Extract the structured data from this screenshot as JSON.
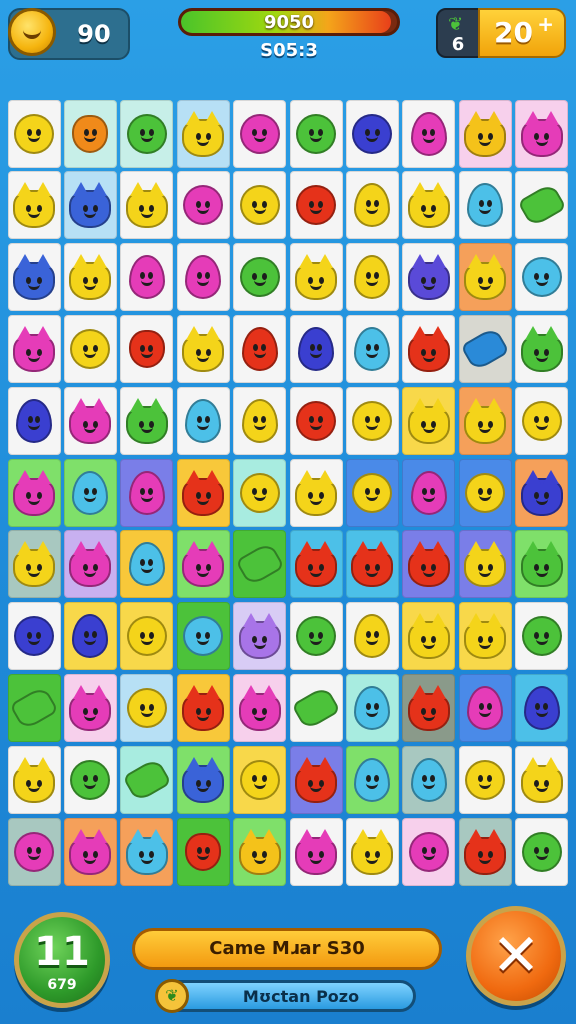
{
  "hud": {
    "coins": "90",
    "score": "9050",
    "score_progress": 0.97,
    "timer": "S05:3",
    "moves": "6",
    "gold": "20",
    "icons": {
      "coin": "smiley-coin-icon",
      "moves": "leaf-icon",
      "gold_add": "plus-icon"
    }
  },
  "board": {
    "rows": [
      [
        [
          "#f5f5f5",
          "round",
          "#f4d41a"
        ],
        [
          "#c7efe8",
          "veg",
          "#f08a1a"
        ],
        [
          "#c7efe8",
          "round",
          "#4cc23a"
        ],
        [
          "#b7e0f5",
          "cat",
          "#f4d41a"
        ],
        [
          "#f5f5f5",
          "round",
          "#e53cb8"
        ],
        [
          "#f5f5f5",
          "round",
          "#4cc23a"
        ],
        [
          "#f5f5f5",
          "round",
          "#3a3fd0"
        ],
        [
          "#f5f5f5",
          "drop",
          "#e53cb8"
        ],
        [
          "#f7d0ec",
          "cat",
          "#f4c21a"
        ],
        [
          "#f7d0ec",
          "cat",
          "#e53cb8"
        ]
      ],
      [
        [
          "#f5f5f5",
          "cat",
          "#f4d41a"
        ],
        [
          "#b7e0f5",
          "cat",
          "#3a63d8"
        ],
        [
          "#f5f5f5",
          "cat",
          "#f4d41a"
        ],
        [
          "#f5f5f5",
          "round",
          "#e53cb8"
        ],
        [
          "#f5f5f5",
          "round",
          "#f4d41a"
        ],
        [
          "#f5f5f5",
          "round",
          "#e5321a"
        ],
        [
          "#f5f5f5",
          "drop",
          "#f4d41a"
        ],
        [
          "#f5f5f5",
          "cat",
          "#f4d41a"
        ],
        [
          "#f5f5f5",
          "drop",
          "#4cc0e8"
        ],
        [
          "#f5f5f5",
          "leaf",
          "#4cc23a"
        ]
      ],
      [
        [
          "#f5f5f5",
          "cat",
          "#3a63d8"
        ],
        [
          "#f5f5f5",
          "cat",
          "#f4d41a"
        ],
        [
          "#f5f5f5",
          "drop",
          "#e53cb8"
        ],
        [
          "#f5f5f5",
          "drop",
          "#e53cb8"
        ],
        [
          "#f5f5f5",
          "round",
          "#4cc23a"
        ],
        [
          "#f5f5f5",
          "cat",
          "#f4d41a"
        ],
        [
          "#f5f5f5",
          "drop",
          "#f4d41a"
        ],
        [
          "#f5f5f5",
          "cat",
          "#5a4ad8"
        ],
        [
          "#f5a05a",
          "cat",
          "#f4d41a"
        ],
        [
          "#f5f5f5",
          "round",
          "#4cc0e8"
        ]
      ],
      [
        [
          "#f5f5f5",
          "cat",
          "#e53cb8"
        ],
        [
          "#f5f5f5",
          "round",
          "#f4d41a"
        ],
        [
          "#f5f5f5",
          "veg",
          "#e5321a"
        ],
        [
          "#f5f5f5",
          "cat",
          "#f4d41a"
        ],
        [
          "#f5f5f5",
          "drop",
          "#e5321a"
        ],
        [
          "#f5f5f5",
          "drop",
          "#3a3fd0"
        ],
        [
          "#f5f5f5",
          "drop",
          "#4cc0e8"
        ],
        [
          "#f5f5f5",
          "cat",
          "#e5321a"
        ],
        [
          "#d8d8d0",
          "leaf",
          "#2a8ad8"
        ],
        [
          "#f5f5f5",
          "cat",
          "#4cc23a"
        ]
      ],
      [
        [
          "#f5f5f5",
          "drop",
          "#3a3fd0"
        ],
        [
          "#f5f5f5",
          "cat",
          "#e53cb8"
        ],
        [
          "#f5f5f5",
          "cat",
          "#4cc23a"
        ],
        [
          "#f5f5f5",
          "drop",
          "#4cc0e8"
        ],
        [
          "#f5f5f5",
          "drop",
          "#f4d41a"
        ],
        [
          "#f5f5f5",
          "round",
          "#e5321a"
        ],
        [
          "#f5f5f5",
          "round",
          "#f4d41a"
        ],
        [
          "#f8d84a",
          "cat",
          "#f4d41a"
        ],
        [
          "#f5a05a",
          "cat",
          "#f4d41a"
        ],
        [
          "#f5f5f5",
          "round",
          "#f4d41a"
        ]
      ],
      [
        [
          "#7fe06a",
          "cat",
          "#e53cb8"
        ],
        [
          "#7fe06a",
          "drop",
          "#4cc0e8"
        ],
        [
          "#7a7ee8",
          "drop",
          "#e53cb8"
        ],
        [
          "#f8c83a",
          "cat",
          "#e5321a"
        ],
        [
          "#a8ece0",
          "round",
          "#f4d41a"
        ],
        [
          "#f5f5f5",
          "cat",
          "#f4d41a"
        ],
        [
          "#4a8ae8",
          "round",
          "#f4d41a"
        ],
        [
          "#4a8ae8",
          "drop",
          "#e53cb8"
        ],
        [
          "#4a8ae8",
          "round",
          "#f4d41a"
        ],
        [
          "#f5a05a",
          "cat",
          "#3a3fd0"
        ]
      ],
      [
        [
          "#a8c8c0",
          "cat",
          "#f4d41a"
        ],
        [
          "#c8b0f0",
          "cat",
          "#e53cb8"
        ],
        [
          "#f8c83a",
          "drop",
          "#4cc0e8"
        ],
        [
          "#7fe06a",
          "cat",
          "#e53cb8"
        ],
        [
          "#4cc23a",
          "leaf",
          "#4cc23a"
        ],
        [
          "#4cc0e8",
          "cat",
          "#e5321a"
        ],
        [
          "#4cc0e8",
          "cat",
          "#e5321a"
        ],
        [
          "#7a7ee8",
          "cat",
          "#e5321a"
        ],
        [
          "#7a7ee8",
          "cat",
          "#f4d41a"
        ],
        [
          "#7fe06a",
          "cat",
          "#4cc23a"
        ]
      ],
      [
        [
          "#f5f5f5",
          "round",
          "#3a3fd0"
        ],
        [
          "#f8d84a",
          "drop",
          "#3a3fd0"
        ],
        [
          "#f8d84a",
          "round",
          "#f4d41a"
        ],
        [
          "#4cc23a",
          "round",
          "#4cc0e8"
        ],
        [
          "#d8ccf5",
          "cat",
          "#a874e8"
        ],
        [
          "#f5f5f5",
          "round",
          "#4cc23a"
        ],
        [
          "#f5f5f5",
          "drop",
          "#f4d41a"
        ],
        [
          "#f8d84a",
          "cat",
          "#f4d41a"
        ],
        [
          "#f8d84a",
          "cat",
          "#f4d41a"
        ],
        [
          "#f5f5f5",
          "round",
          "#4cc23a"
        ]
      ],
      [
        [
          "#4cc23a",
          "leaf",
          "#4cc23a"
        ],
        [
          "#f7d0ec",
          "cat",
          "#e53cb8"
        ],
        [
          "#b7e0f5",
          "round",
          "#f4d41a"
        ],
        [
          "#f8c83a",
          "cat",
          "#e5321a"
        ],
        [
          "#f7d0ec",
          "cat",
          "#e53cb8"
        ],
        [
          "#f5f5f5",
          "leaf",
          "#4cc23a"
        ],
        [
          "#a8ece0",
          "drop",
          "#4cc0e8"
        ],
        [
          "#8a9a8a",
          "cat",
          "#e5321a"
        ],
        [
          "#4a8ae8",
          "drop",
          "#e53cb8"
        ],
        [
          "#4cc0e8",
          "drop",
          "#3a3fd0"
        ]
      ],
      [
        [
          "#f5f5f5",
          "cat",
          "#f4d41a"
        ],
        [
          "#f5f5f5",
          "round",
          "#4cc23a"
        ],
        [
          "#a8ece0",
          "leaf",
          "#4cc23a"
        ],
        [
          "#7fe06a",
          "cat",
          "#3a63d8"
        ],
        [
          "#f8d84a",
          "round",
          "#f4d41a"
        ],
        [
          "#7a7ee8",
          "cat",
          "#e5321a"
        ],
        [
          "#7fe06a",
          "drop",
          "#4cc0e8"
        ],
        [
          "#a8c8c0",
          "drop",
          "#4cc0e8"
        ],
        [
          "#f5f5f5",
          "round",
          "#f4d41a"
        ],
        [
          "#f5f5f5",
          "cat",
          "#f4d41a"
        ]
      ],
      [
        [
          "#a8c8c0",
          "round",
          "#e53cb8"
        ],
        [
          "#f5a05a",
          "cat",
          "#e53cb8"
        ],
        [
          "#f5a05a",
          "cat",
          "#4cc0e8"
        ],
        [
          "#4cc23a",
          "veg",
          "#e5321a"
        ],
        [
          "#7fe06a",
          "cat",
          "#f4c21a"
        ],
        [
          "#f5f5f5",
          "cat",
          "#e53cb8"
        ],
        [
          "#f5f5f5",
          "cat",
          "#f4d41a"
        ],
        [
          "#f7d0ec",
          "round",
          "#e53cb8"
        ],
        [
          "#a8c8c0",
          "cat",
          "#e5321a"
        ],
        [
          "#f5f5f5",
          "round",
          "#4cc23a"
        ]
      ]
    ]
  },
  "bottom": {
    "level": "11",
    "level_sub": "679",
    "banner_primary": "Came Mɹar S30",
    "banner_secondary": "Mʊctan Pozo",
    "icons": {
      "secondary": "leaf-icon",
      "close": "close-icon"
    }
  }
}
